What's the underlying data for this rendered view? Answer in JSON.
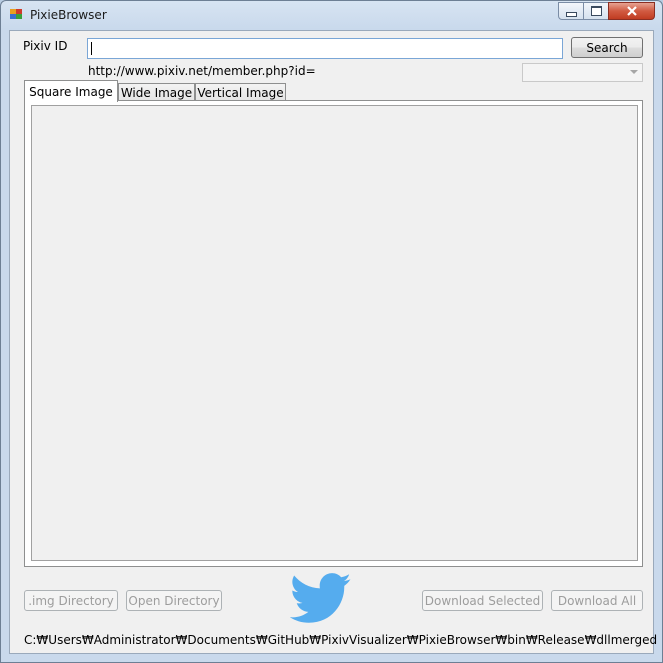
{
  "window": {
    "title": "PixieBrowser",
    "controls": [
      "minimize",
      "maximize",
      "close"
    ]
  },
  "form": {
    "pixiv_id_label": "Pixiv ID",
    "pixiv_id_value": "",
    "search_label": "Search",
    "url_text": "http://www.pixiv.net/member.php?id=",
    "dropdown_value": ""
  },
  "tabs": [
    {
      "label": "Square Image",
      "active": true
    },
    {
      "label": "Wide Image",
      "active": false
    },
    {
      "label": "Vertical Image",
      "active": false
    }
  ],
  "buttons": {
    "img_directory": ".img Directory",
    "open_directory": "Open Directory",
    "download_selected": "Download Selected",
    "download_all": "Download All"
  },
  "status": {
    "path": "C:₩Users₩Administrator₩Documents₩GitHub₩PixivVisualizer₩PixieBrowser₩bin₩Release₩dllmerged"
  },
  "icons": {
    "twitter": "twitter-bird-icon"
  },
  "colors": {
    "twitter_blue": "#55acee",
    "input_border": "#7aa6d6",
    "close_red": "#c9452c"
  }
}
